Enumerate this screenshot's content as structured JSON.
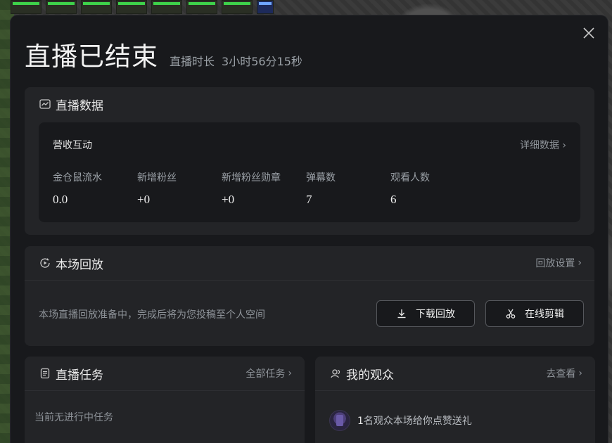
{
  "modal": {
    "title": "直播已结束",
    "duration_label": "直播时长",
    "duration_value": "3小时56分15秒"
  },
  "data_card": {
    "title": "直播数据",
    "inner_title": "营收互动",
    "detail_link": "详细数据",
    "stats": [
      {
        "label": "金仓鼠流水",
        "value": "0.0"
      },
      {
        "label": "新增粉丝",
        "value": "+0"
      },
      {
        "label": "新增粉丝勋章",
        "value": "+0"
      },
      {
        "label": "弹幕数",
        "value": "7"
      },
      {
        "label": "观看人数",
        "value": "6"
      }
    ]
  },
  "replay_card": {
    "title": "本场回放",
    "settings_link": "回放设置",
    "status_text": "本场直播回放准备中，完成后将为您投稿至个人空间",
    "download_label": "下载回放",
    "edit_label": "在线剪辑"
  },
  "tasks_card": {
    "title": "直播任务",
    "all_link": "全部任务",
    "empty_text": "当前无进行中任务"
  },
  "audience_card": {
    "title": "我的观众",
    "view_link": "去查看",
    "count": "1",
    "text": "名观众本场给你点赞送礼"
  },
  "icons": {
    "close": "close-icon",
    "chart": "line-chart-icon",
    "replay": "play-circle-icon",
    "download": "download-icon",
    "scissors": "scissors-icon",
    "task": "document-icon",
    "audience": "users-icon",
    "chevron": "chevron-right-icon"
  },
  "colors": {
    "modal_bg": "#18191c",
    "card_bg": "#232427",
    "text_primary": "#e6e6e6",
    "text_muted": "#8e9399"
  }
}
